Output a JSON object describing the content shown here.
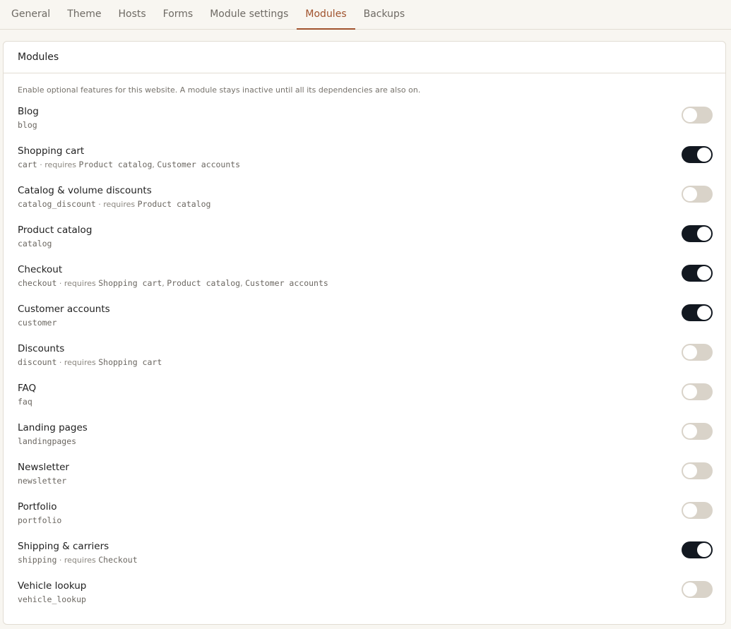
{
  "tabs": [
    {
      "label": "General",
      "active": false
    },
    {
      "label": "Theme",
      "active": false
    },
    {
      "label": "Hosts",
      "active": false
    },
    {
      "label": "Forms",
      "active": false
    },
    {
      "label": "Module settings",
      "active": false
    },
    {
      "label": "Modules",
      "active": true
    },
    {
      "label": "Backups",
      "active": false
    }
  ],
  "card": {
    "title": "Modules",
    "description": "Enable optional features for this website. A module stays inactive until all its dependencies are also on."
  },
  "colors": {
    "accent": "#a0522d",
    "toggle_on": "#121820",
    "toggle_off": "#d9d3c9"
  },
  "modules": [
    {
      "name": "Blog",
      "id": "blog",
      "requires_label": "",
      "requires": [],
      "enabled": false
    },
    {
      "name": "Shopping cart",
      "id": "cart",
      "requires_label": "· requires",
      "requires": [
        "Product catalog",
        "Customer accounts"
      ],
      "enabled": true
    },
    {
      "name": "Catalog & volume discounts",
      "id": "catalog_discount",
      "requires_label": "· requires",
      "requires": [
        "Product catalog"
      ],
      "enabled": false
    },
    {
      "name": "Product catalog",
      "id": "catalog",
      "requires_label": "",
      "requires": [],
      "enabled": true
    },
    {
      "name": "Checkout",
      "id": "checkout",
      "requires_label": "· requires",
      "requires": [
        "Shopping cart",
        "Product catalog",
        "Customer accounts"
      ],
      "enabled": true
    },
    {
      "name": "Customer accounts",
      "id": "customer",
      "requires_label": "",
      "requires": [],
      "enabled": true
    },
    {
      "name": "Discounts",
      "id": "discount",
      "requires_label": "· requires",
      "requires": [
        "Shopping cart"
      ],
      "enabled": false
    },
    {
      "name": "FAQ",
      "id": "faq",
      "requires_label": "",
      "requires": [],
      "enabled": false
    },
    {
      "name": "Landing pages",
      "id": "landingpages",
      "requires_label": "",
      "requires": [],
      "enabled": false
    },
    {
      "name": "Newsletter",
      "id": "newsletter",
      "requires_label": "",
      "requires": [],
      "enabled": false
    },
    {
      "name": "Portfolio",
      "id": "portfolio",
      "requires_label": "",
      "requires": [],
      "enabled": false
    },
    {
      "name": "Shipping & carriers",
      "id": "shipping",
      "requires_label": "· requires",
      "requires": [
        "Checkout"
      ],
      "enabled": true
    },
    {
      "name": "Vehicle lookup",
      "id": "vehicle_lookup",
      "requires_label": "",
      "requires": [],
      "enabled": false
    }
  ]
}
